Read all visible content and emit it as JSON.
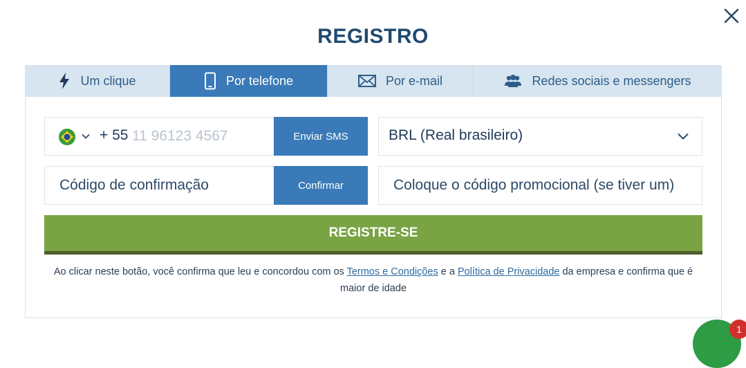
{
  "title": "REGISTRO",
  "tabs": [
    {
      "label": "Um clique",
      "icon": "lightning-icon"
    },
    {
      "label": "Por telefone",
      "icon": "phone-icon"
    },
    {
      "label": "Por e-mail",
      "icon": "envelope-icon"
    },
    {
      "label": "Redes sociais e messengers",
      "icon": "users-icon"
    }
  ],
  "active_tab": "Por telefone",
  "phone": {
    "country_icon": "brazil-flag-icon",
    "prefix": "+ 55",
    "placeholder": "11 96123 4567",
    "send_sms_label": "Enviar SMS"
  },
  "currency": {
    "value": "BRL (Real brasileiro)"
  },
  "confirmation": {
    "placeholder": "Código de confirmação",
    "confirm_label": "Confirmar"
  },
  "promo": {
    "placeholder": "Coloque o código promocional (se tiver um)"
  },
  "register_label": "REGISTRE-SE",
  "legal": {
    "part1": "Ao clicar neste botão, você confirma que leu e concordou com os ",
    "terms_link": "Termos e Condições",
    "part2": " e a ",
    "privacy_link": "Política de Privacidade",
    "part3": " da empresa e confirma que é maior de idade"
  },
  "chat_badge": "1",
  "colors": {
    "primary_blue": "#3a7ab8",
    "tab_inactive": "#d7e5f0",
    "register_green": "#7aa444",
    "title_navy": "#1f4a70"
  }
}
